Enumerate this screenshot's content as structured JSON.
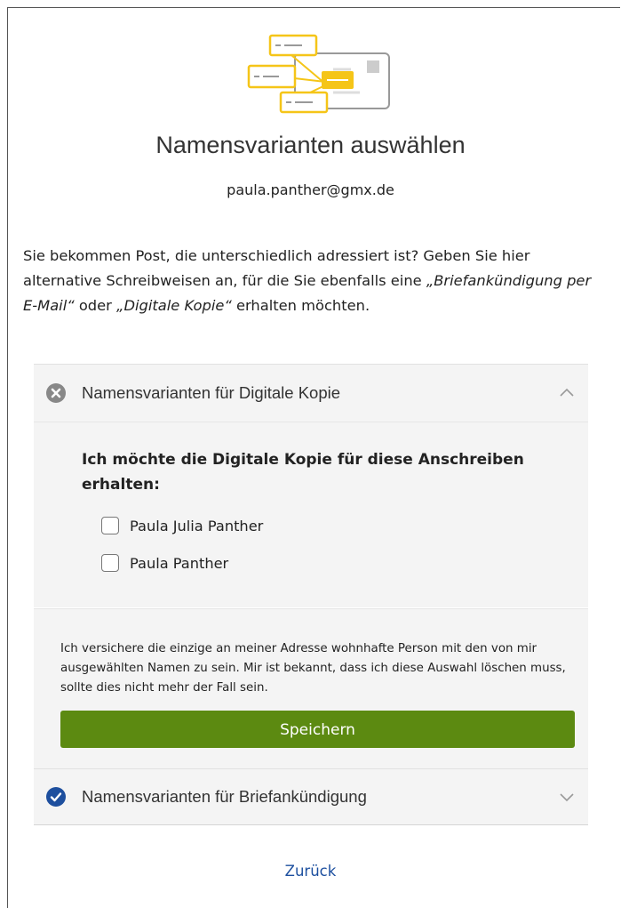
{
  "header": {
    "title": "Namensvarianten auswählen",
    "email": "paula.panther@gmx.de",
    "illustration_icon": "address-variants-illustration"
  },
  "intro": {
    "part1": "Sie bekommen Post, die unterschiedlich adressiert ist? Geben Sie hier alternative Schreibweisen an, für die Sie ebenfalls eine ",
    "italic1": "„Briefankündigung per E-Mail“",
    "part2": " oder ",
    "italic2": "„Digitale Kopie“",
    "part3": " erhalten möchten."
  },
  "accordion_digital": {
    "label": "Namensvarianten für Digitale Kopie",
    "status_icon": "x-circle-icon",
    "expanded": true,
    "heading": "Ich möchte die Digitale Kopie für diese Anschreiben erhalten:",
    "options": [
      {
        "label": "Paula Julia Panther",
        "checked": false
      },
      {
        "label": "Paula Panther",
        "checked": false
      }
    ]
  },
  "footer": {
    "disclaimer": "Ich versichere die einzige an meiner Adresse wohnhafte Person mit den von mir ausgewählten Namen zu sein. Mir ist bekannt, dass ich diese Auswahl löschen muss, sollte dies nicht mehr der Fall sein.",
    "save_label": "Speichern"
  },
  "accordion_letter": {
    "label": "Namensvarianten für Briefankündigung",
    "status_icon": "check-circle-icon",
    "expanded": false
  },
  "back_label": "Zurück",
  "colors": {
    "primary_button": "#5c8a11",
    "link": "#1c4f9f",
    "check_icon": "#1e4f9e",
    "x_icon": "#888888",
    "illustration_accent": "#f5c518"
  }
}
